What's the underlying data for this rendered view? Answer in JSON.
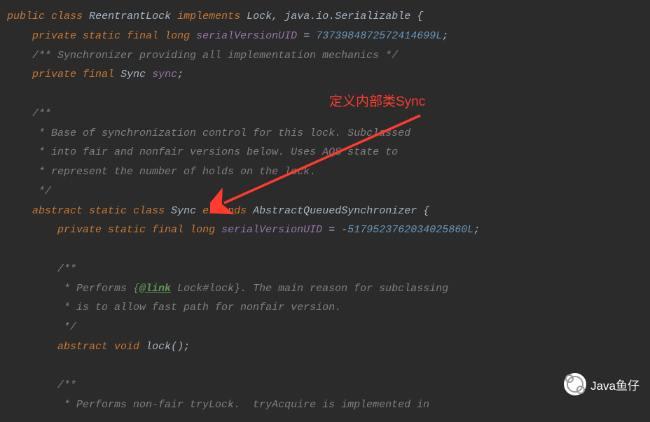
{
  "annotation": {
    "label": "定义内部类Sync"
  },
  "watermark": {
    "text": "Java鱼仔"
  },
  "code": {
    "l1": {
      "kw1": "public",
      "kw2": "class",
      "cls": "ReentrantLock",
      "kw3": "implements",
      "t1": "Lock",
      "c": ",",
      "t2": "java.io.Serializable",
      "br": "{"
    },
    "l2": {
      "kw1": "private",
      "kw2": "static",
      "kw3": "final",
      "kw4": "long",
      "fld": "serialVersionUID",
      "eq": "=",
      "num": "7373984872572414699L",
      "sc": ";"
    },
    "l3": {
      "cmt": "/** Synchronizer providing all implementation mechanics */"
    },
    "l4": {
      "kw1": "private",
      "kw2": "final",
      "typ": "Sync",
      "fld": "sync",
      "sc": ";"
    },
    "l6": {
      "cmt": "/**"
    },
    "l7": {
      "cmt": " * Base of synchronization control for this lock. Subclassed"
    },
    "l8": {
      "cmt": " * into fair and nonfair versions below. Uses AQS state to"
    },
    "l9": {
      "cmt": " * represent the number of holds on the lock."
    },
    "l10": {
      "cmt": " */"
    },
    "l11": {
      "kw1": "abstract",
      "kw2": "static",
      "kw3": "class",
      "cls": "Sync",
      "kw4": "extends",
      "sup": "AbstractQueuedSynchronizer",
      "br": "{"
    },
    "l12": {
      "kw1": "private",
      "kw2": "static",
      "kw3": "final",
      "kw4": "long",
      "fld": "serialVersionUID",
      "eq": "=",
      "neg": "-",
      "num": "5179523762034025860L",
      "sc": ";"
    },
    "l14": {
      "cmt": "/**"
    },
    "l15": {
      "s": " * Performs {",
      "link": "@link",
      "rest": " Lock#lock}. The main reason for subclassing"
    },
    "l16": {
      "cmt": " * is to allow fast path for nonfair version."
    },
    "l17": {
      "cmt": " */"
    },
    "l18": {
      "kw1": "abstract",
      "kw2": "void",
      "mth": "lock",
      "par": "()",
      "sc": ";"
    },
    "l20": {
      "cmt": "/**"
    },
    "l21": {
      "cmt": " * Performs non-fair tryLock.  tryAcquire is implemented in"
    }
  }
}
